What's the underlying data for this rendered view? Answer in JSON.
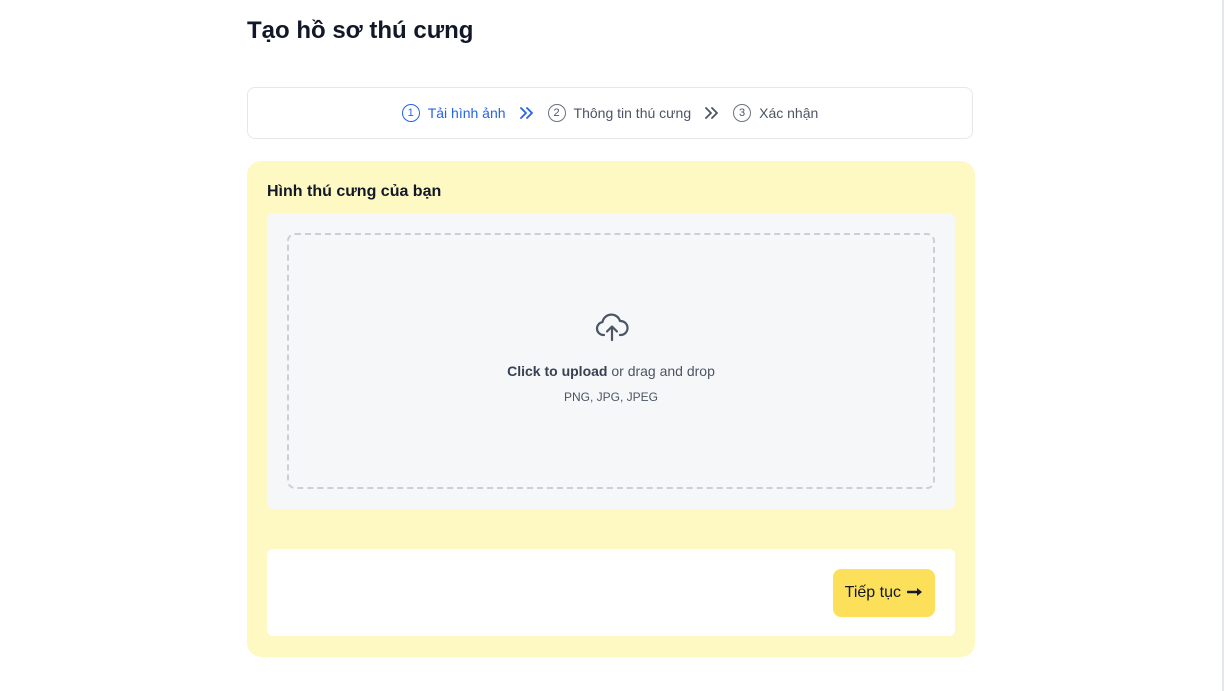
{
  "page": {
    "title": "Tạo hồ sơ thú cưng"
  },
  "stepper": {
    "steps": [
      {
        "number": "1",
        "label": "Tải hình ảnh",
        "active": true
      },
      {
        "number": "2",
        "label": "Thông tin thú cưng",
        "active": false
      },
      {
        "number": "3",
        "label": "Xác nhận",
        "active": false
      }
    ]
  },
  "upload": {
    "section_label": "Hình thú cưng của bạn",
    "click_text": "Click to upload",
    "drag_text": " or drag and drop",
    "formats": "PNG, JPG, JPEG",
    "icon": "cloud-upload-icon"
  },
  "footer": {
    "next_label": "Tiếp tục",
    "next_icon": "arrow-right-icon"
  },
  "colors": {
    "accent": "#2563eb",
    "card_bg": "#fef9c3",
    "button_bg": "#fde05a"
  }
}
